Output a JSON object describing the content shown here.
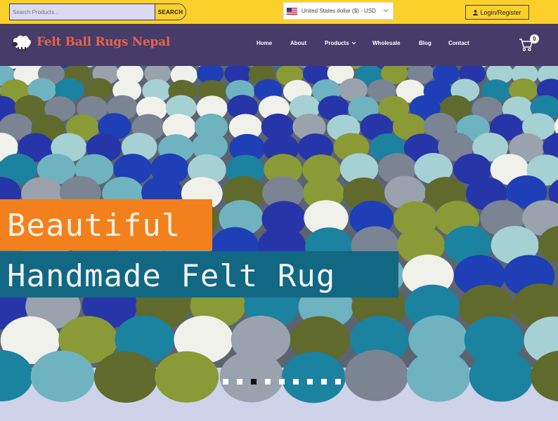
{
  "topbar": {
    "search_placeholder": "Search Products...",
    "search_button": "SEARCH",
    "currency": "United States dollar ($) - USD",
    "login": "Login/Register"
  },
  "navbar": {
    "brand": "Felt Ball Rugs Nepal",
    "items": [
      "Home",
      "About",
      "Products",
      "Wholesale",
      "Blog",
      "Contact"
    ],
    "cart_count": "0"
  },
  "hero": {
    "line1": "Beautiful",
    "line2": "Handmade Felt Rug",
    "slide_count": 9,
    "active_slide": 3
  },
  "colors": {
    "topbar": "#fcd02b",
    "navbar": "#463b69",
    "brand": "#e8634b",
    "banner_orange": "#f2801d",
    "banner_teal": "#126783"
  }
}
